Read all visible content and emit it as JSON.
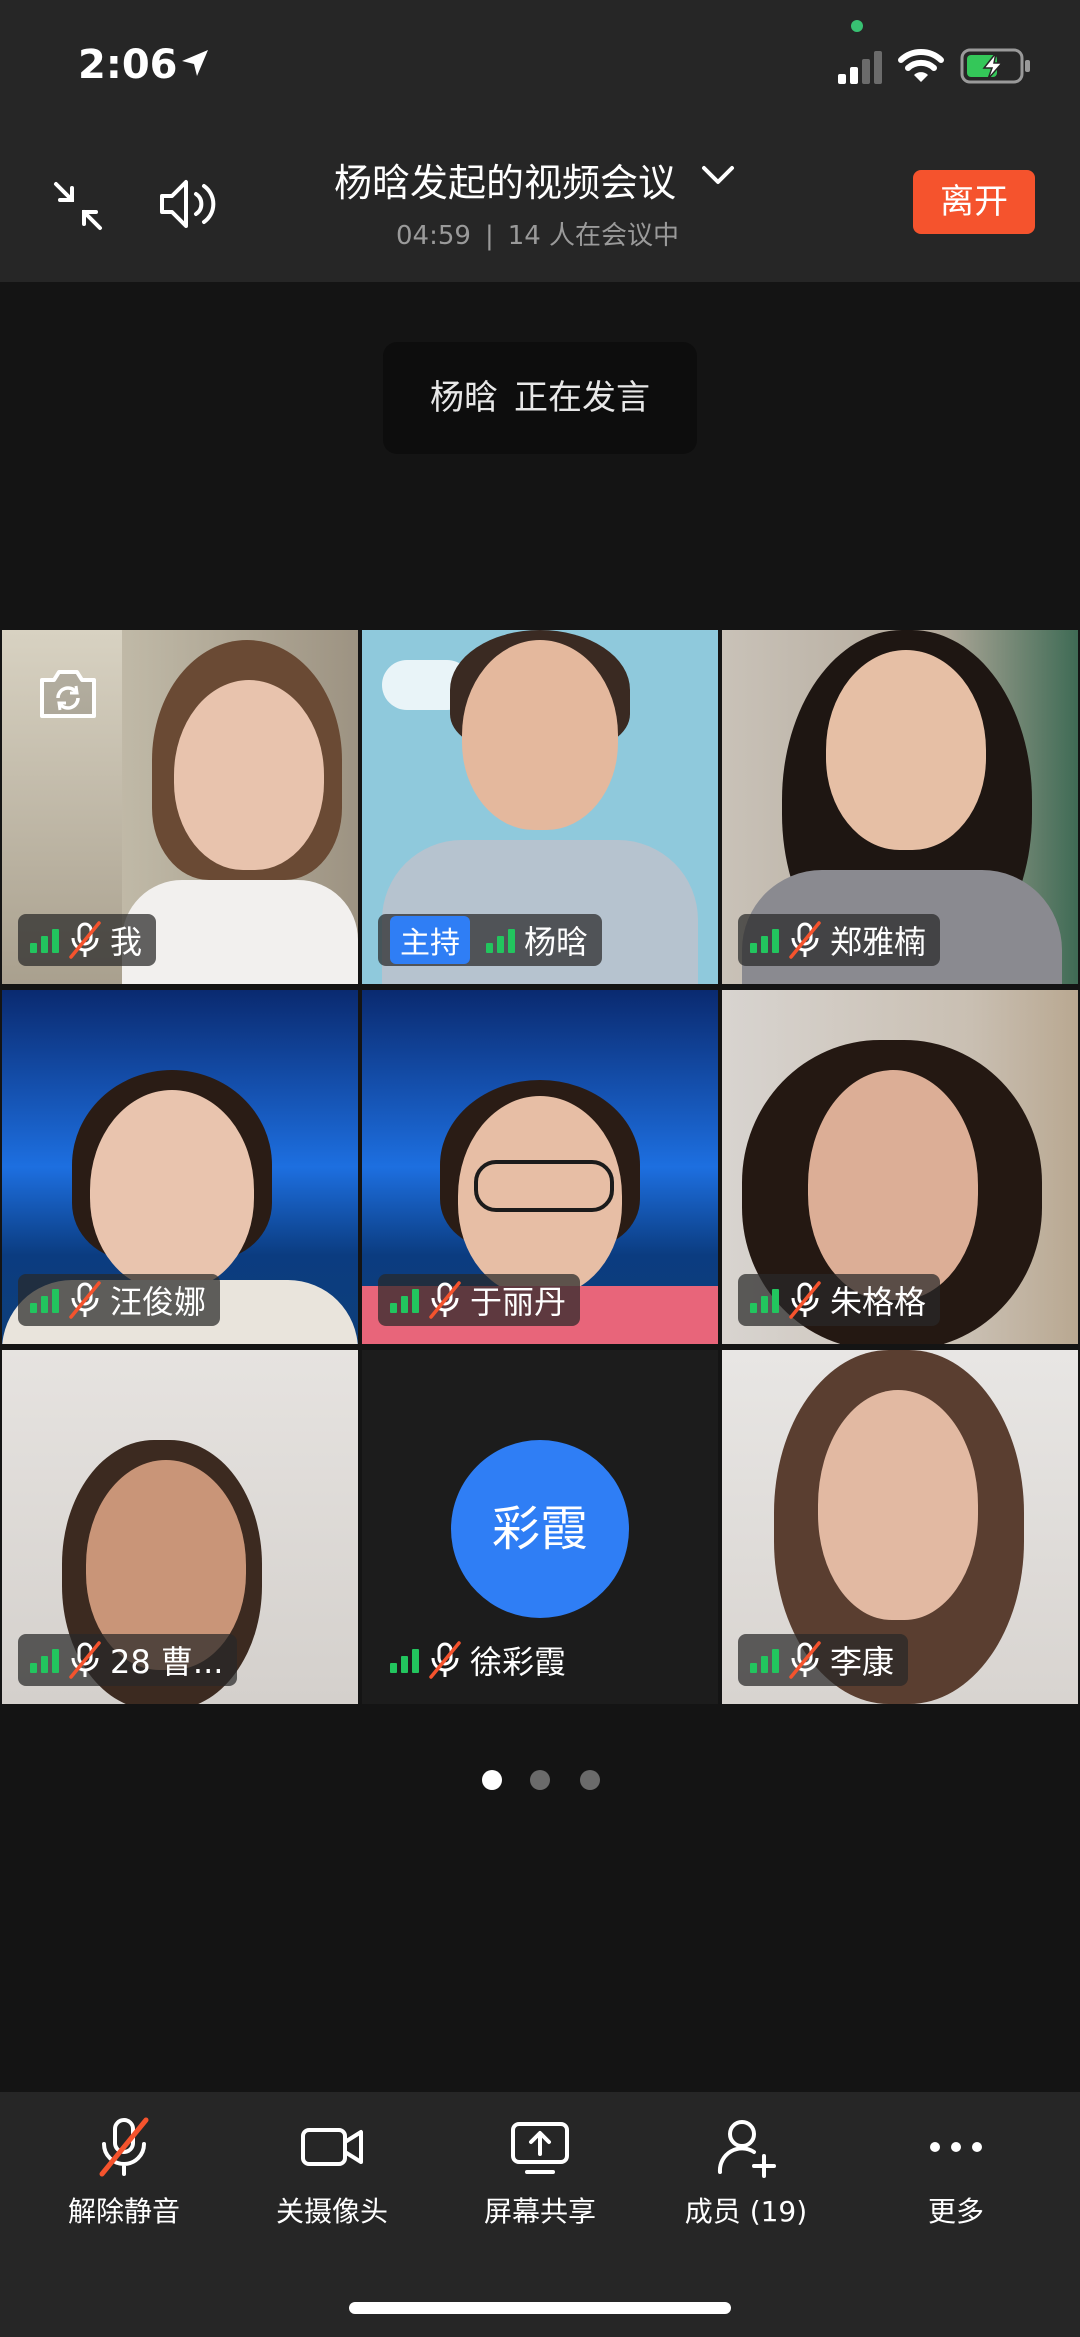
{
  "status_bar": {
    "time": "2:06"
  },
  "header": {
    "title": "杨晗发起的视频会议",
    "duration": "04:59",
    "separator": "|",
    "participants_text": "14 人在会议中",
    "leave_label": "离开"
  },
  "toast": {
    "speaker": "杨晗",
    "status": "正在发言"
  },
  "tiles": [
    {
      "name": "我"
    },
    {
      "name": "杨晗",
      "host_tag": "主持"
    },
    {
      "name": "郑雅楠"
    },
    {
      "name": "汪俊娜"
    },
    {
      "name": "于丽丹"
    },
    {
      "name": "朱格格"
    },
    {
      "name": "28 曹..."
    },
    {
      "name": "徐彩霞",
      "avatar_text": "彩霞"
    },
    {
      "name": "李康"
    }
  ],
  "pagination": {
    "pages": 3,
    "current": 1
  },
  "toolbar": {
    "unmute": "解除静音",
    "camera_off": "关摄像头",
    "screen_share": "屏幕共享",
    "members": "成员 (19)",
    "more": "更多"
  },
  "colors": {
    "accent": "#2f7ef5",
    "leave": "#f5532d",
    "active_speaker": "#22c55e",
    "signal": "#22c55e",
    "muted_slash": "#f5532d"
  }
}
